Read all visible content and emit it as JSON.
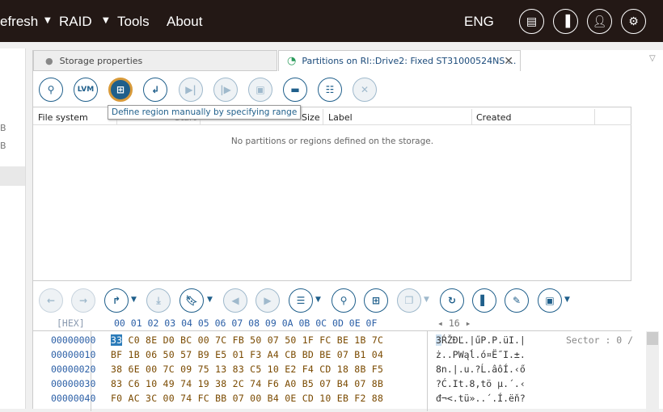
{
  "menu": {
    "items": [
      "efresh",
      "RAID",
      "Tools",
      "About"
    ],
    "language": "ENG"
  },
  "top_icons": [
    "windows-icon",
    "panel-icon",
    "user-icon",
    "gear-icon"
  ],
  "sidebar": {
    "items": [
      "B",
      "B"
    ]
  },
  "tabs": [
    {
      "label": "Storage properties"
    },
    {
      "label": "Partitions on RI::Drive2: Fixed ST31000524NS ..."
    }
  ],
  "toolbar": {
    "tooltip": "Define region manually by specifying range"
  },
  "table": {
    "columns": [
      "File system",
      "Start",
      "Size",
      "Label",
      "Created"
    ],
    "empty_message": "No partitions or regions defined on the storage."
  },
  "hex": {
    "header_label": "[HEX]",
    "columns": "00 01 02 03 04 05 06 07 08 09 0A 0B 0C 0D 0E 0F",
    "bytes_per_row": "16",
    "sector": "Sector : 0 /",
    "rows": [
      {
        "offset": "00000000",
        "first": "33",
        "bytes": " C0 8E D0 BC 00 7C FB 50 07 50 1F FC BE 1B 7C",
        "afirst": "3",
        "ascii": "ŔŽĐĽ.|űP.P.üI.|"
      },
      {
        "offset": "00000010",
        "first": "",
        "bytes": "BF 1B 06 50 57 B9 E5 01 F3 A4 CB BD BE 07 B1 04",
        "afirst": "",
        "ascii": "ż..PWąĺ.ó¤Ë˝I.±."
      },
      {
        "offset": "00000020",
        "first": "",
        "bytes": "38 6E 00 7C 09 75 13 83 C5 10 E2 F4 CD 18 8B F5",
        "afirst": "",
        "ascii": "8n.|.u.?Ĺ.âôÍ.‹ő"
      },
      {
        "offset": "00000030",
        "first": "",
        "bytes": "83 C6 10 49 74 19 38 2C 74 F6 A0 B5 07 B4 07 8B",
        "afirst": "",
        "ascii": "?Ć.It.8,tö µ.´.‹"
      },
      {
        "offset": "00000040",
        "first": "",
        "bytes": "F0 AC 3C 00 74 FC BB 07 00 B4 0E CD 10 EB F2 88",
        "afirst": "",
        "ascii": "đ¬<.tü»..´.Í.ëň?"
      }
    ]
  }
}
